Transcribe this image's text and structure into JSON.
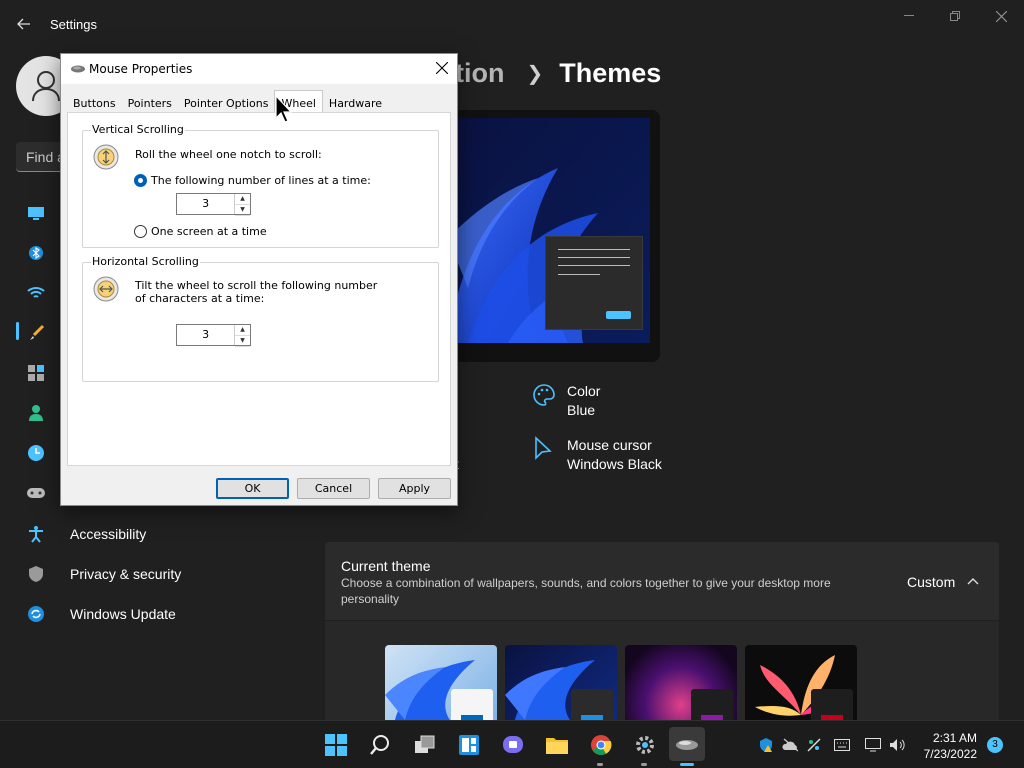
{
  "settings": {
    "title": "Settings",
    "search_placeholder": "Find a setting",
    "search_visible_text": "Find a",
    "breadcrumb": {
      "parent": "ation",
      "current": "Themes"
    },
    "nav": [
      {
        "label": "Accessibility",
        "icon": "accessibility-icon"
      },
      {
        "label": "Privacy & security",
        "icon": "shield-icon"
      },
      {
        "label": "Windows Update",
        "icon": "update-icon"
      }
    ],
    "properties": {
      "color": {
        "label": "Color",
        "value": "Blue",
        "icon": "palette-icon"
      },
      "mouse_cursor": {
        "label": "Mouse cursor",
        "value": "Windows Black",
        "icon": "cursor-icon"
      },
      "hidden_fragment": "lt"
    },
    "current_theme": {
      "title": "Current theme",
      "description": "Choose a combination of wallpapers, sounds, and colors together to give your desktop more personality",
      "value": "Custom"
    }
  },
  "dialog": {
    "title": "Mouse Properties",
    "tabs": [
      "Buttons",
      "Pointers",
      "Pointer Options",
      "Wheel",
      "Hardware"
    ],
    "active_tab": "Wheel",
    "vertical": {
      "label": "Vertical Scrolling",
      "instruction": "Roll the wheel one notch to scroll:",
      "option_lines": "The following number of lines at a time:",
      "option_screen": "One screen at a time",
      "lines_value": "3",
      "selected": "lines"
    },
    "horizontal": {
      "label": "Horizontal Scrolling",
      "instruction_line1": "Tilt the wheel to scroll the following number",
      "instruction_line2": "of characters at a time:",
      "chars_value": "3"
    },
    "buttons": {
      "ok": "OK",
      "cancel": "Cancel",
      "apply": "Apply"
    }
  },
  "taskbar": {
    "apps": [
      "start-icon",
      "search-icon",
      "task-view-icon",
      "widgets-icon",
      "teams-chat-icon",
      "file-explorer-icon",
      "chrome-icon",
      "settings-icon",
      "mouse-properties-icon"
    ],
    "time": "2:31 AM",
    "date": "7/23/2022",
    "notification_count": "3"
  },
  "colors": {
    "accent": "#4cc2ff",
    "background": "#202020",
    "dialog_default_button": "#005fb8"
  }
}
